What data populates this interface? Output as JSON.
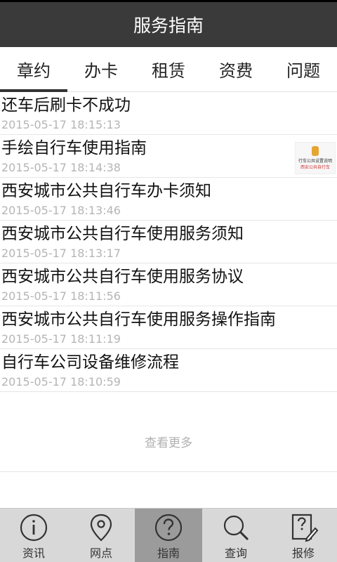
{
  "header": {
    "title": "服务指南"
  },
  "tabs": [
    {
      "label": "章约"
    },
    {
      "label": "办卡"
    },
    {
      "label": "租赁"
    },
    {
      "label": "资费"
    },
    {
      "label": "问题"
    }
  ],
  "active_tab_index": 0,
  "list": {
    "items": [
      {
        "title": "还车后刷卡不成功",
        "date": "2015-05-17 18:15:13"
      },
      {
        "title": "手绘自行车使用指南",
        "date": "2015-05-17 18:14:38",
        "thumb": {
          "line1": "行车公共设置说明",
          "line2": "西安公共自行车"
        }
      },
      {
        "title": "西安城市公共自行车办卡须知",
        "date": "2015-05-17 18:13:46"
      },
      {
        "title": "西安城市公共自行车使用服务须知",
        "date": "2015-05-17 18:13:17"
      },
      {
        "title": "西安城市公共自行车使用服务协议",
        "date": "2015-05-17 18:11:56"
      },
      {
        "title": "西安城市公共自行车使用服务操作指南",
        "date": "2015-05-17 18:11:19"
      },
      {
        "title": "自行车公司设备维修流程",
        "date": "2015-05-17 18:10:59"
      }
    ],
    "load_more_label": "查看更多"
  },
  "bottom_nav": {
    "items": [
      {
        "label": "资讯",
        "icon": "info-icon"
      },
      {
        "label": "网点",
        "icon": "location-pin-icon"
      },
      {
        "label": "指南",
        "icon": "question-icon"
      },
      {
        "label": "查询",
        "icon": "search-icon"
      },
      {
        "label": "报修",
        "icon": "report-edit-icon"
      }
    ],
    "active_index": 2
  }
}
